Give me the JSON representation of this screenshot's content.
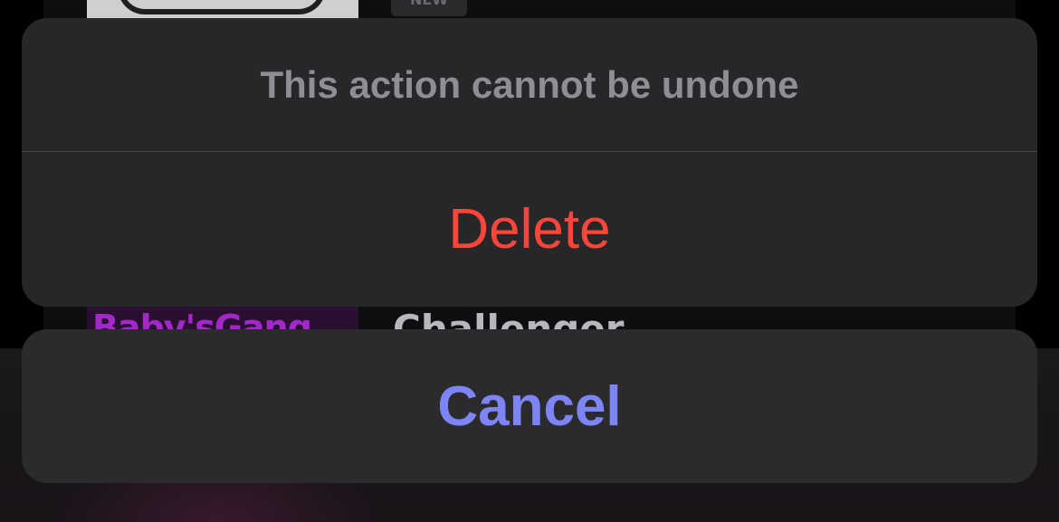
{
  "background": {
    "top_item": {
      "badge": "NEW"
    },
    "bottom_item": {
      "thumbnail_text": "Baby'sGang",
      "title": "Challenger"
    }
  },
  "action_sheet": {
    "message": "This action cannot be undone",
    "delete_label": "Delete",
    "cancel_label": "Cancel"
  },
  "colors": {
    "destructive": "#ff453a",
    "accent": "#7d85f5",
    "sheet_background": "#28282a",
    "message_text": "#8e8e93"
  }
}
